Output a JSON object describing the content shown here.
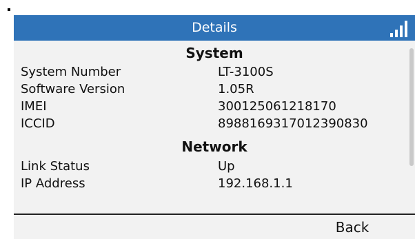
{
  "header": {
    "title": "Details",
    "signal_icon": "signal-bars-icon"
  },
  "sections": [
    {
      "title": "System",
      "rows": [
        {
          "label": "System Number",
          "value": "LT-3100S"
        },
        {
          "label": "Software Version",
          "value": "1.05R"
        },
        {
          "label": "IMEI",
          "value": "300125061218170"
        },
        {
          "label": "ICCID",
          "value": "8988169317012390830"
        }
      ]
    },
    {
      "title": "Network",
      "rows": [
        {
          "label": "Link Status",
          "value": "Up"
        },
        {
          "label": "IP Address",
          "value": "192.168.1.1"
        }
      ]
    }
  ],
  "softkeys": {
    "back_label": "Back"
  },
  "colors": {
    "titlebar": "#2f73b8",
    "screen_bg": "#f2f2f2"
  }
}
